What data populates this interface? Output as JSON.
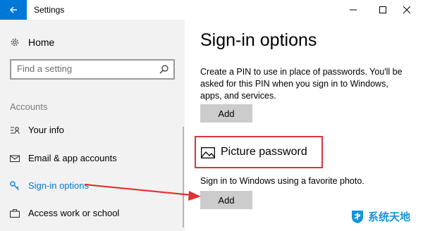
{
  "window": {
    "title": "Settings",
    "accent": "#0078d7"
  },
  "sidebar": {
    "home_label": "Home",
    "search_placeholder": "Find a setting",
    "section_label": "Accounts",
    "items": [
      {
        "label": "Your info",
        "icon": "person-icon"
      },
      {
        "label": "Email & app accounts",
        "icon": "mail-icon"
      },
      {
        "label": "Sign-in options",
        "icon": "key-icon",
        "active": true
      },
      {
        "label": "Access work or school",
        "icon": "briefcase-icon"
      }
    ]
  },
  "main": {
    "title": "Sign-in options",
    "pin_description": "Create a PIN to use in place of passwords. You'll be asked for this PIN when you sign in to Windows, apps, and services.",
    "pin_add_label": "Add",
    "picture_title": "Picture password",
    "picture_description": "Sign in to Windows using a favorite photo.",
    "picture_add_label": "Add"
  },
  "annotation": {
    "highlight_color": "#d9373b"
  },
  "watermark": {
    "text": "系统天地"
  }
}
